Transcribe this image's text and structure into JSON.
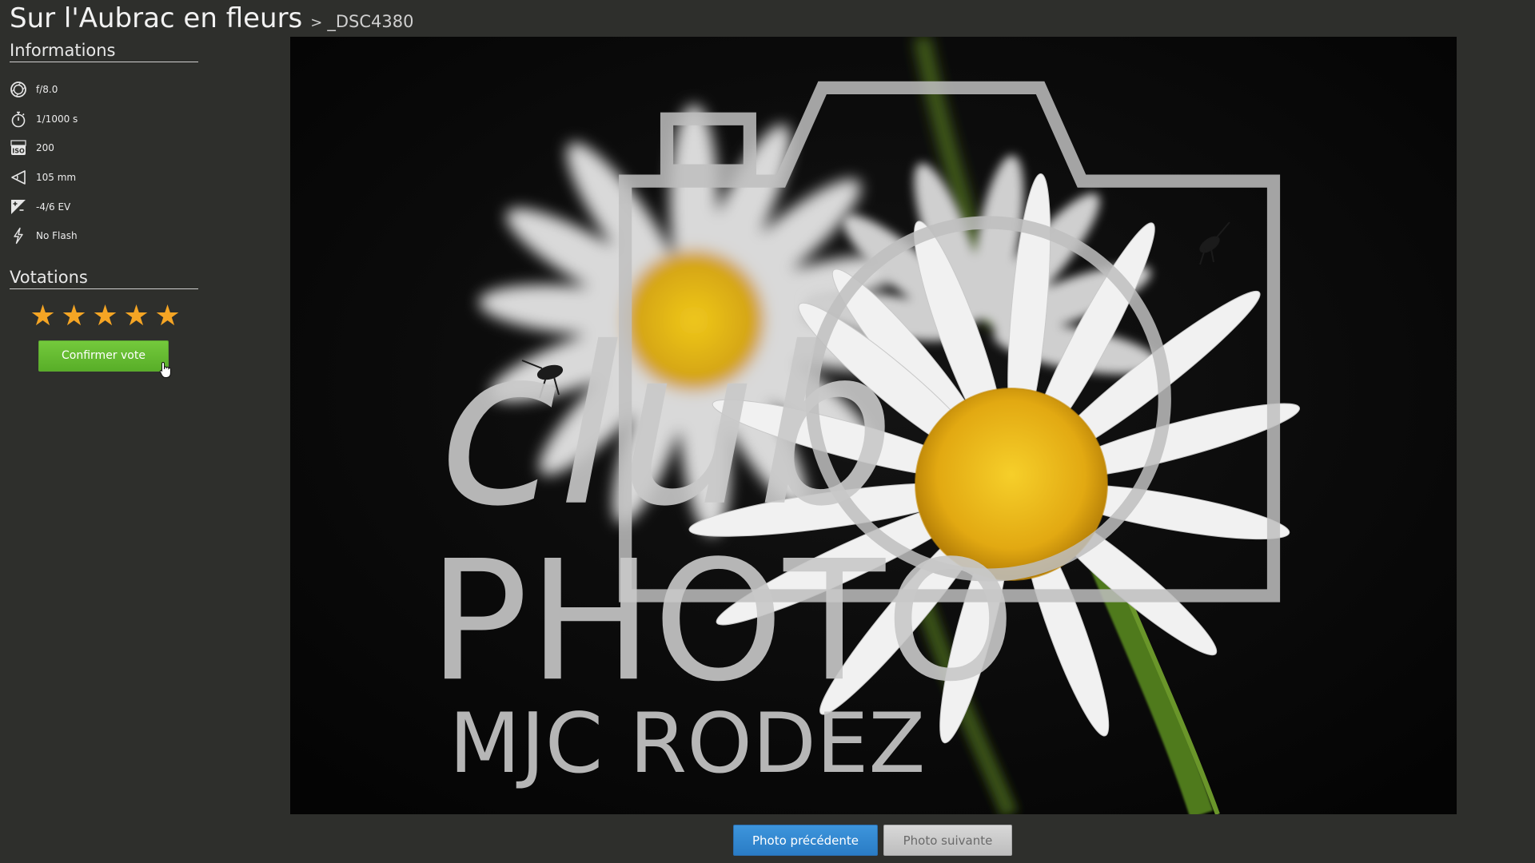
{
  "header": {
    "album_title": "Sur l'Aubrac en fleurs",
    "separator": ">",
    "photo_name": "_DSC4380"
  },
  "sidebar": {
    "informations_heading": "Informations",
    "info": [
      {
        "icon": "aperture-icon",
        "value": "f/8.0"
      },
      {
        "icon": "stopwatch-icon",
        "value": "1/1000 s"
      },
      {
        "icon": "iso-icon",
        "value": "200"
      },
      {
        "icon": "focal-length-icon",
        "value": "105 mm"
      },
      {
        "icon": "exposure-icon",
        "value": "-4/6 EV"
      },
      {
        "icon": "flash-icon",
        "value": "No Flash"
      }
    ],
    "votations_heading": "Votations",
    "stars": {
      "count": 5,
      "icon": "star-icon",
      "color": "#f5a524"
    },
    "confirm_label": "Confirmer vote"
  },
  "photo": {
    "watermark": {
      "line1": "club",
      "line2": "PHOTO",
      "line3": "MJC RODEZ"
    }
  },
  "navigation": {
    "prev_label": "Photo précédente",
    "next_label": "Photo suivante"
  },
  "colors": {
    "background": "#2e2f2c",
    "prev_button": "#2a7cc5",
    "confirm_button": "#58ae28",
    "next_button": "#bdbdbd"
  }
}
